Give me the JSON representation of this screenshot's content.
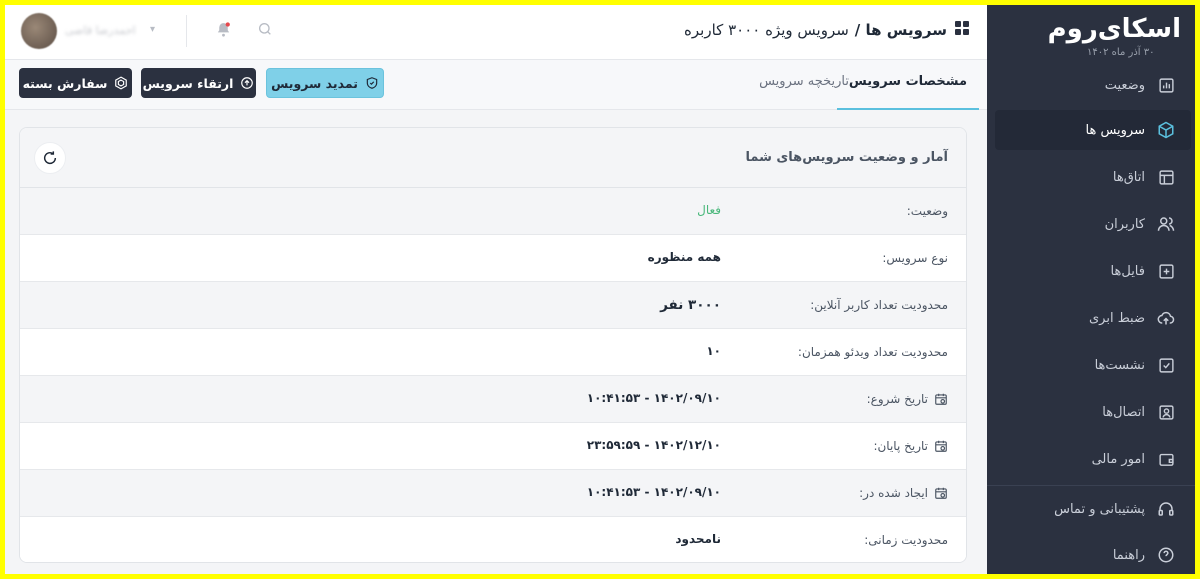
{
  "header": {
    "title_section": "سرویس ها /",
    "title_page": "سرویس ویژه ۳۰۰۰ کاربره",
    "user_name": "احمدرضا قاضی"
  },
  "sidebar": {
    "logo": "اسکای‌روم",
    "date": "۳۰ آذر ماه ۱۴۰۲",
    "items": [
      {
        "label": "وضعیت",
        "icon": "chart-icon"
      },
      {
        "label": "سرویس ها",
        "icon": "cube-icon"
      },
      {
        "label": "اتاق‌ها",
        "icon": "layout-icon"
      },
      {
        "label": "کاربران",
        "icon": "users-icon"
      },
      {
        "label": "فایل‌ها",
        "icon": "file-plus-icon"
      },
      {
        "label": "ضبط ابری",
        "icon": "cloud-upload-icon"
      },
      {
        "label": "نشست‌ها",
        "icon": "checkbox-icon"
      },
      {
        "label": "اتصال‌ها",
        "icon": "user-card-icon"
      },
      {
        "label": "امور مالی",
        "icon": "wallet-icon"
      },
      {
        "label": "پشتیبانی و تماس",
        "icon": "headset-icon"
      },
      {
        "label": "راهنما",
        "icon": "help-icon"
      }
    ]
  },
  "tabs": {
    "specs": "مشخصات سرویس",
    "history": "تاریخچه سرویس"
  },
  "actions": {
    "renew": "تمدید سرویس",
    "upgrade": "ارتقاء سرویس",
    "order": "سفارش بسته"
  },
  "card": {
    "title": "آمار و وضعیت سرویس‌های شما",
    "rows": [
      {
        "label": "وضعیت:",
        "value": "فعال"
      },
      {
        "label": "نوع سرویس:",
        "value": "همه منظوره"
      },
      {
        "label": "محدودیت تعداد کاربر آنلاین:",
        "value": "۳۰۰۰ نفر"
      },
      {
        "label": "محدودیت تعداد ویدئو همزمان:",
        "value": "۱۰"
      },
      {
        "label": "تاریخ شروع:",
        "value": "۱۴۰۲/۰۹/۱۰ - ۱۰:۴۱:۵۳"
      },
      {
        "label": "تاریخ پایان:",
        "value": "۱۴۰۲/۱۲/۱۰ - ۲۳:۵۹:۵۹"
      },
      {
        "label": "ایجاد شده در:",
        "value": "۱۴۰۲/۰۹/۱۰ - ۱۰:۴۱:۵۳"
      },
      {
        "label": "محدودیت زمانی:",
        "value": "نامحدود"
      }
    ]
  },
  "colors": {
    "sidebar_bg": "#2b3140",
    "accent": "#5bc0de",
    "active_status": "#48b77a",
    "dark_button": "#2b3140"
  }
}
